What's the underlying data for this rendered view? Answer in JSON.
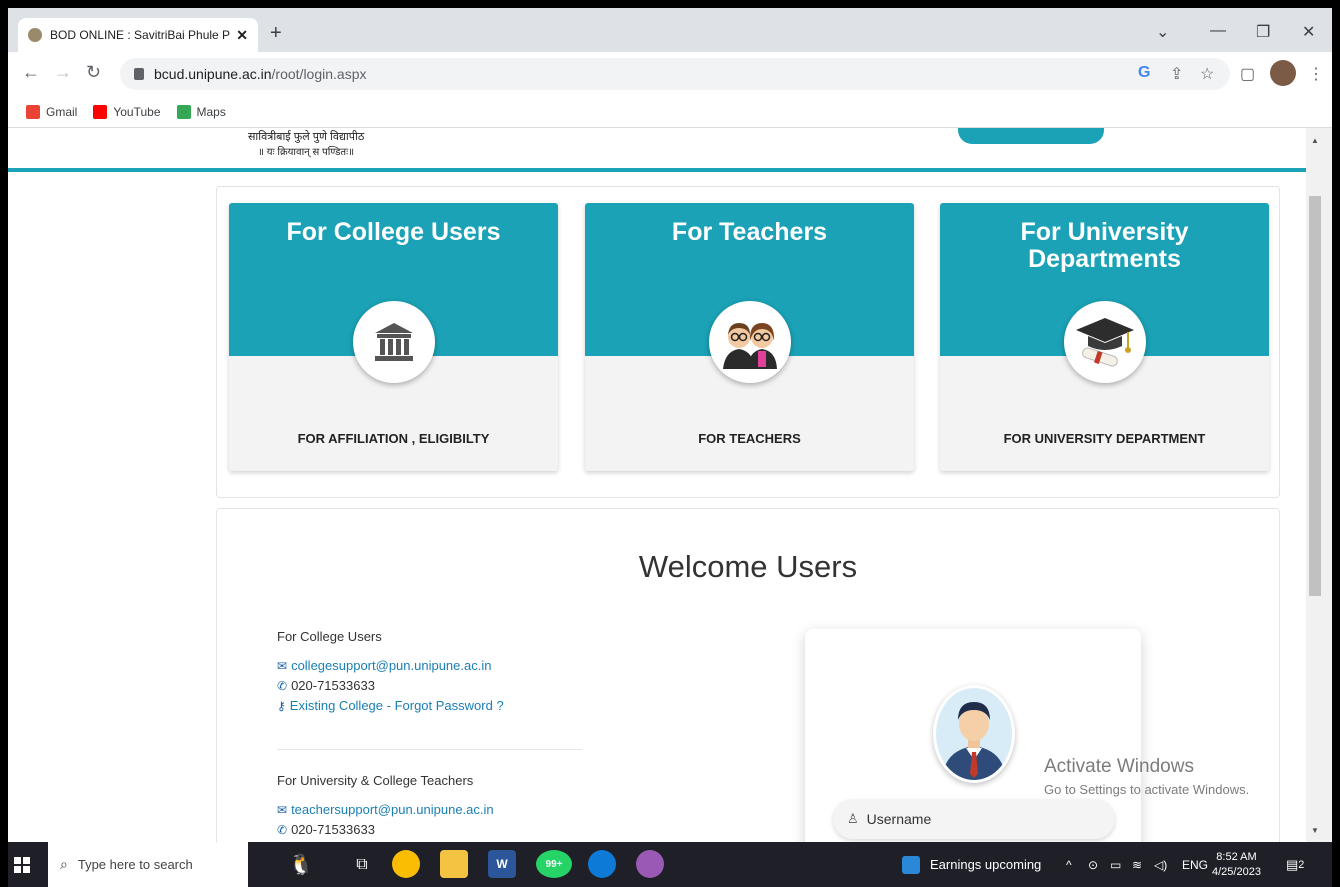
{
  "browser": {
    "tab_title": "BOD ONLINE : SavitriBai Phule Pu",
    "tab_close": "✕",
    "new_tab": "+",
    "url_host": "bcud.unipune.ac.in",
    "url_path": "/root/login.aspx",
    "bookmarks": [
      "Gmail",
      "YouTube",
      "Maps"
    ]
  },
  "header": {
    "marathi_line1": "सावित्रीबाई फुले पुणे विद्यापीठ",
    "marathi_line2": "॥ यः क्रियावान् स पण्डितः॥"
  },
  "cards": [
    {
      "title": "For College Users",
      "subtitle": "FOR AFFILIATION , ELIGIBILTY",
      "icon": "college-building-icon"
    },
    {
      "title": "For Teachers",
      "subtitle": "FOR TEACHERS",
      "icon": "teachers-icon"
    },
    {
      "title": "For University Departments",
      "subtitle": "FOR UNIVERSITY DEPARTMENT",
      "icon": "graduation-cap-icon"
    }
  ],
  "welcome": {
    "title": "Welcome Users",
    "college": {
      "heading": "For College Users",
      "email": "collegesupport@pun.unipune.ac.in",
      "phone": "020-71533633",
      "forgot": "Existing College - Forgot Password ?"
    },
    "teachers": {
      "heading": "For University & College Teachers",
      "email": "teachersupport@pun.unipune.ac.in",
      "phone": "020-71533633"
    },
    "login": {
      "username_placeholder": "Username"
    }
  },
  "watermark": {
    "line1": "Activate Windows",
    "line2": "Go to Settings to activate Windows."
  },
  "taskbar": {
    "search_placeholder": "Type here to search",
    "news": "Earnings upcoming",
    "whatsapp_badge": "99+",
    "lang": "ENG",
    "time": "8:52 AM",
    "date": "4/25/2023",
    "notif_count": "2"
  },
  "colors": {
    "accent": "#1ba2b6",
    "link": "#1a7fb5"
  }
}
